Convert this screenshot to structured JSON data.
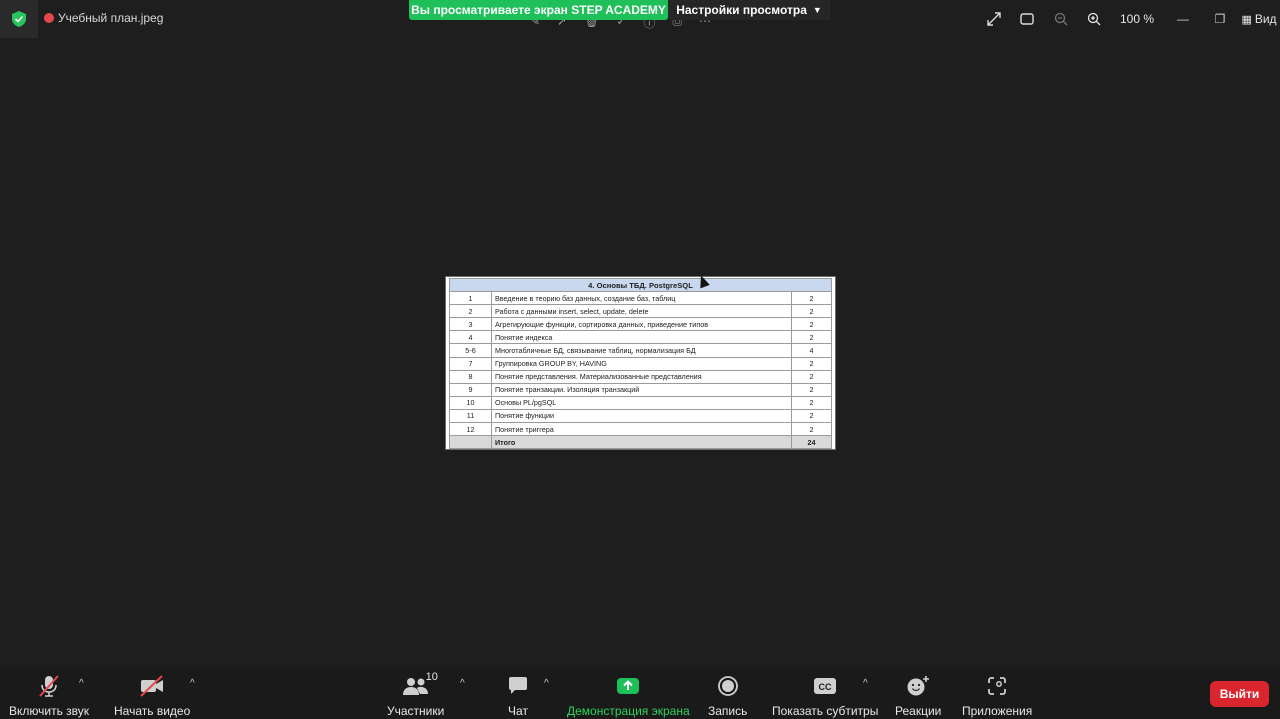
{
  "app": {
    "rec_label": "Запись",
    "file_label": "Учебный план.jpeg",
    "share_banner": "Вы просматриваете экран STEP ACADEMY",
    "view_settings": "Настройки просмотра",
    "zoom": "100 %",
    "view": "Вид"
  },
  "document": {
    "title": "4. Основы ТБД. PostgreSQL",
    "rows": [
      {
        "num": "1",
        "topic": "Введение в теорию баз данных, создание баз, таблиц",
        "hours": "2"
      },
      {
        "num": "2",
        "topic": "Работа с данными insert, select, update, delete",
        "hours": "2"
      },
      {
        "num": "3",
        "topic": "Агрегирующие функции, сортировка данных, приведение типов",
        "hours": "2"
      },
      {
        "num": "4",
        "topic": "Понятие индекса",
        "hours": "2"
      },
      {
        "num": "5-6",
        "topic": "Многотабличные БД, связывание таблиц, нормализация БД",
        "hours": "4"
      },
      {
        "num": "7",
        "topic": "Группировка GROUP BY, HAVING",
        "hours": "2"
      },
      {
        "num": "8",
        "topic": "Понятие представления. Материализованные представления",
        "hours": "2"
      },
      {
        "num": "9",
        "topic": "Понятие транзакции. Изоляция транзакций",
        "hours": "2"
      },
      {
        "num": "10",
        "topic": "Основы PL/pgSQL",
        "hours": "2"
      },
      {
        "num": "11",
        "topic": "Понятие функции",
        "hours": "2"
      },
      {
        "num": "12",
        "topic": "Понятие триггера",
        "hours": "2"
      }
    ],
    "total_label": "Итого",
    "total_hours": "24"
  },
  "toolbar": {
    "audio": "Включить звук",
    "video": "Начать видео",
    "participants": "Участники",
    "participants_count": "10",
    "chat": "Чат",
    "share": "Демонстрация экрана",
    "record": "Запись",
    "captions": "Показать субтитры",
    "reactions": "Реакции",
    "apps": "Приложения",
    "leave": "Выйти"
  },
  "colors": {
    "share_green": "#1fbf5a",
    "leave_red": "#d9262e",
    "header_blue": "#c9d8ee"
  }
}
